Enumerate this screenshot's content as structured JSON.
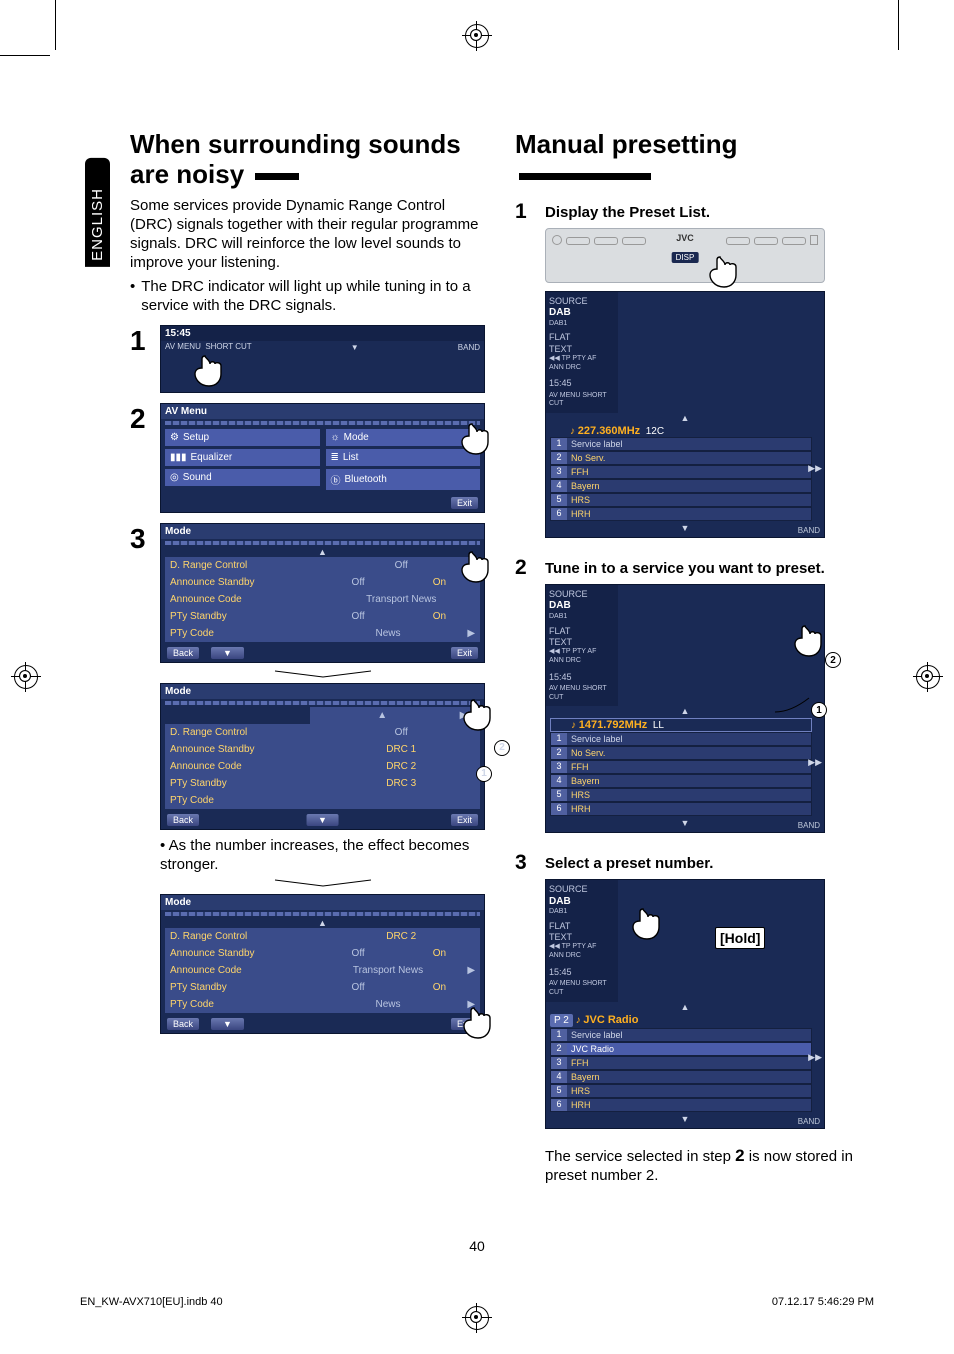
{
  "lang_tab": "ENGLISH",
  "left": {
    "heading": "When surrounding sounds are noisy",
    "paragraph": "Some services provide Dynamic Range Control (DRC) signals together with their regular programme signals. DRC will reinforce the low level sounds to improve your listening.",
    "bullet": "The DRC indicator will light up while tuning in to a service with the DRC signals.",
    "step1_clock": "15:45",
    "step1_avmenu": "AV MENU",
    "step1_shortcut": "SHORT CUT",
    "step1_band": "BAND",
    "avmenu_title": "AV Menu",
    "avmenu_items": [
      "Setup",
      "Equalizer",
      "Sound",
      "Mode",
      "List",
      "Bluetooth"
    ],
    "exit": "Exit",
    "mode_title": "Mode",
    "mode_rows": [
      "D. Range Control",
      "Announce Standby",
      "Announce Code",
      "PTy Standby",
      "PTy Code"
    ],
    "back": "Back",
    "off": "Off",
    "on": "On",
    "transport_news": "Transport News",
    "news": "News",
    "drc1": "DRC 1",
    "drc2": "DRC 2",
    "drc3": "DRC 3",
    "note_after": "As the number increases, the effect becomes stronger."
  },
  "right": {
    "heading": "Manual presetting",
    "s1": "Display the Preset List.",
    "s2": "Tune in to a service you want to preset.",
    "s3": "Select a preset number.",
    "jvc": "JVC",
    "disp": "DISP",
    "side_source": "SOURCE",
    "side_dab": "DAB",
    "side_dab1": "DAB1",
    "side_flat": "FLAT",
    "side_text": "TEXT",
    "side_tp_pty_af": "TP  PTY  AF",
    "side_ann_drc": "ANN    DRC",
    "side_clock": "15:45",
    "side_avmenu": "AV MENU",
    "side_shortcut": "SHORT CUT",
    "band": "BAND",
    "freq1": "227.360MHz",
    "ch1": "12C",
    "freq2": "1471.792MHz",
    "ch2": "LL",
    "preset_labels": [
      "Service label",
      "No Serv.",
      "FFH",
      "Bayern",
      "HRS",
      "HRH"
    ],
    "preset_labels_3": [
      "Service label",
      "JVC Radio",
      "FFH",
      "Bayern",
      "HRS",
      "HRH"
    ],
    "p2": "P 2",
    "jvc_radio": "JVC Radio",
    "hold": "[Hold]",
    "final_line_a": "The service selected in step ",
    "final_step_ref": "2",
    "final_line_b": " is now stored in preset number 2."
  },
  "page_number": "40",
  "footer_left": "EN_KW-AVX710[EU].indb   40",
  "footer_right": "07.12.17   5:46:29 PM"
}
